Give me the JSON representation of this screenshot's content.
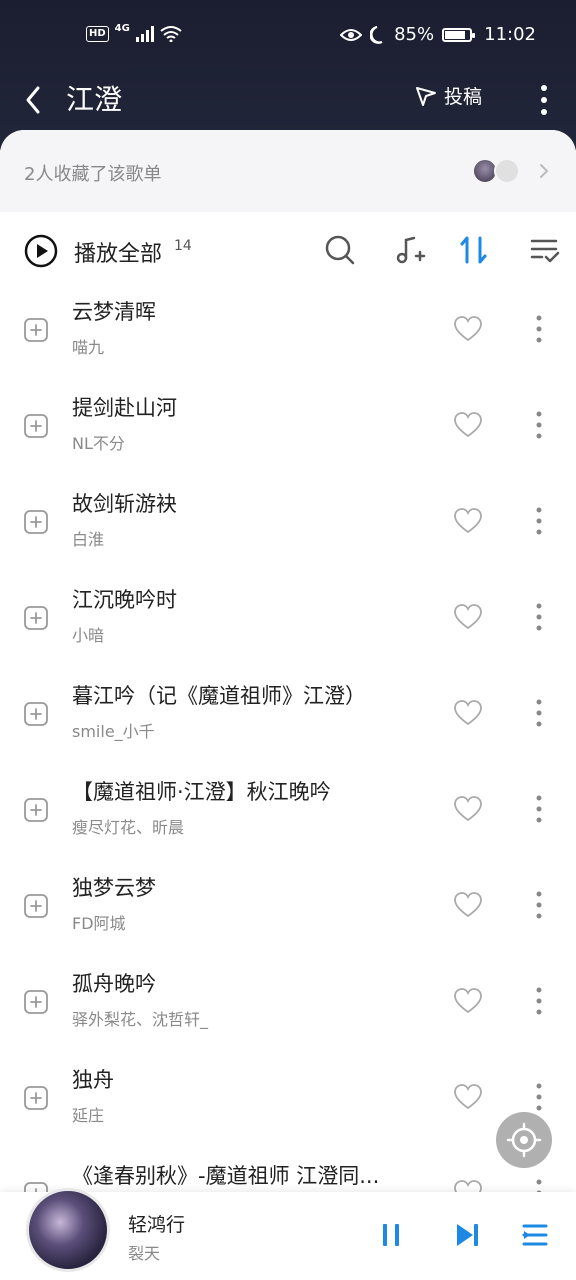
{
  "status_bar": {
    "network": "4G",
    "battery": "85%",
    "time": "11:02"
  },
  "header": {
    "title": "江澄",
    "submit_label": "投稿"
  },
  "collect": {
    "text": "2人收藏了该歌单"
  },
  "toolbar": {
    "play_all_label": "播放全部",
    "count": "14"
  },
  "songs": [
    {
      "title": "云梦清晖",
      "artist": "喵九"
    },
    {
      "title": "提剑赴山河",
      "artist": "NL不分"
    },
    {
      "title": "故剑斩游袂",
      "artist": "白淮"
    },
    {
      "title": "江沉晚吟时",
      "artist": "小暗"
    },
    {
      "title": "暮江吟（记《魔道祖师》江澄）",
      "artist": "smile_小千"
    },
    {
      "title": "【魔道祖师·江澄】秋江晚吟",
      "artist": "瘦尽灯花、昕晨"
    },
    {
      "title": "独梦云梦",
      "artist": "FD阿城"
    },
    {
      "title": "孤舟晚吟",
      "artist": "驿外梨花、沈哲轩_"
    },
    {
      "title": "独舟",
      "artist": "延庄"
    },
    {
      "title": "《逢春别秋》-魔道祖师 江澄同...",
      "artist": ""
    }
  ],
  "player": {
    "title": "轻鸿行",
    "artist": "裂天",
    "battery_fraction": 0.85
  },
  "colors": {
    "accent": "#1e88e5",
    "header_bg": "#1b1e30",
    "muted": "#8a8a8a"
  },
  "icons": [
    "back-icon",
    "send-icon",
    "more-vertical-icon",
    "play-circle-icon",
    "search-icon",
    "add-music-icon",
    "sort-icon",
    "multi-select-icon",
    "add-square-icon",
    "heart-icon",
    "pause-icon",
    "next-icon",
    "playlist-icon",
    "locate-icon"
  ]
}
